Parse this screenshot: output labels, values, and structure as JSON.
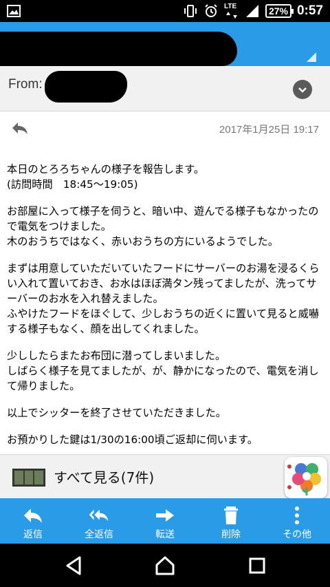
{
  "status_bar": {
    "network": "LTE",
    "battery": "27%",
    "time": "0:57"
  },
  "from": {
    "label": "From:"
  },
  "message": {
    "date": "2017年1月25日 19:17",
    "paragraphs": [
      "本日のとろろちゃんの様子を報告します。\n(訪問時間　18:45〜19:05)",
      "お部屋に入って様子を伺うと、暗い中、遊んでる様子もなかったので電気をつけました。\n木のおうちではなく、赤いおうちの方にいるようでした。",
      "まずは用意していただいていたフードにサーバーのお湯を浸るくらい入れて置いておき、お水はほぼ満タン残ってましたが、洗ってサーバーのお水を入れ替えました。\nふやけたフードをほぐして、少しおうちの近くに置いて見ると威嚇する様子もなく、顔を出してくれました。",
      "少ししたらまたお布団に潜ってしまいました。\nしばらく様子を見てましたが、が、静かになったので、電気を消して帰りました。",
      "以上でシッターを終了させていただきました。",
      "お預かりした鍵は1/30の16:00頃ご返却に伺います。"
    ]
  },
  "attachments": {
    "label": "すべて見る(7件)"
  },
  "actions": [
    {
      "label": "返信",
      "icon": "reply-icon"
    },
    {
      "label": "全返信",
      "icon": "reply-all-icon"
    },
    {
      "label": "転送",
      "icon": "forward-icon"
    },
    {
      "label": "削除",
      "icon": "trash-icon"
    },
    {
      "label": "その他",
      "icon": "more-vertical-icon"
    }
  ],
  "colors": {
    "accent": "#2a9be6",
    "status_bar": "#000000",
    "panel": "#f1f1f1"
  }
}
